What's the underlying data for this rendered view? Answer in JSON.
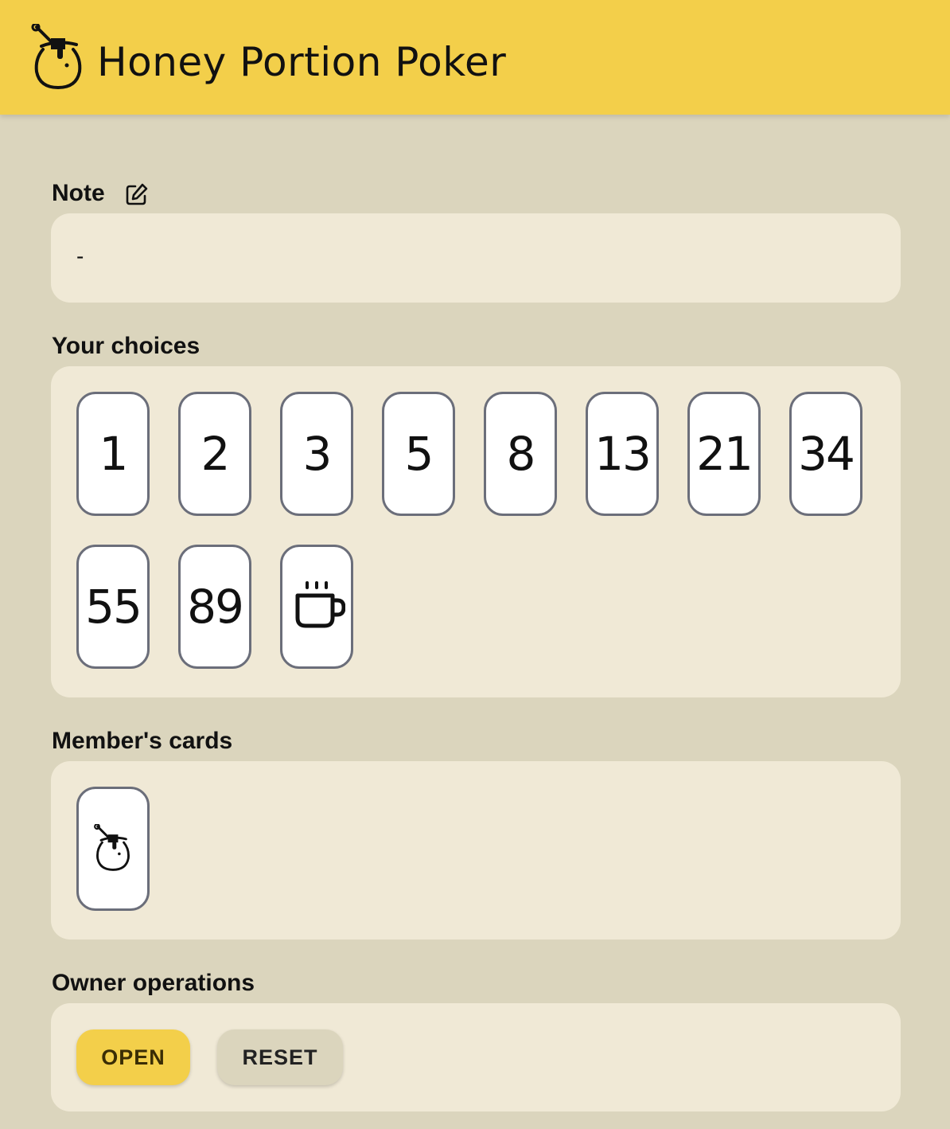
{
  "header": {
    "title": "Honey Portion Poker",
    "logo_icon": "honey-pot-icon"
  },
  "note": {
    "label": "Note",
    "edit_icon": "edit-icon",
    "value": "-"
  },
  "choices": {
    "label": "Your choices",
    "cards": [
      {
        "label": "1"
      },
      {
        "label": "2"
      },
      {
        "label": "3"
      },
      {
        "label": "5"
      },
      {
        "label": "8"
      },
      {
        "label": "13"
      },
      {
        "label": "21"
      },
      {
        "label": "34"
      },
      {
        "label": "55"
      },
      {
        "label": "89"
      },
      {
        "label": "",
        "icon": "coffee-cup-icon"
      }
    ]
  },
  "members": {
    "label": "Member's cards",
    "cards": [
      {
        "icon": "honey-pot-icon",
        "state": "hidden"
      }
    ]
  },
  "owner": {
    "label": "Owner operations",
    "open_label": "OPEN",
    "reset_label": "RESET"
  },
  "colors": {
    "header_bg": "#f3cf4a",
    "page_bg": "#dbd5bd",
    "panel_bg": "#f0e9d6",
    "card_border": "#6b6e7a",
    "open_button": "#f3cf4a",
    "reset_button": "#dbd5bd"
  }
}
